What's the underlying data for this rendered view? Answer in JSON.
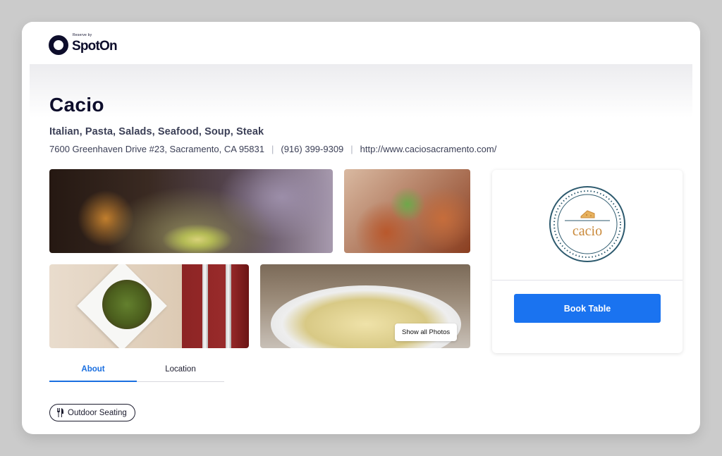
{
  "header": {
    "logo_small": "Reserve by",
    "logo_main": "SpotOn"
  },
  "restaurant": {
    "name": "Cacio",
    "cuisines": "Italian, Pasta, Salads, Seafood, Soup, Steak",
    "address": "7600 Greenhaven Drive #23, Sacramento, CA 95831",
    "phone": "(916) 399-9309",
    "website": "http://www.caciosacramento.com/"
  },
  "gallery": {
    "show_all_label": "Show all Photos"
  },
  "tabs": [
    {
      "label": "About",
      "active": true
    },
    {
      "label": "Location",
      "active": false
    }
  ],
  "amenities": [
    {
      "label": "Outdoor Seating",
      "icon": "fork-knife-icon"
    }
  ],
  "booking": {
    "logo_text": "cacio",
    "button_label": "Book Table"
  },
  "colors": {
    "brand_dark": "#0d0d2b",
    "accent_blue": "#1a73f0",
    "badge_teal": "#2d5a6e",
    "badge_gold": "#c9893a"
  }
}
